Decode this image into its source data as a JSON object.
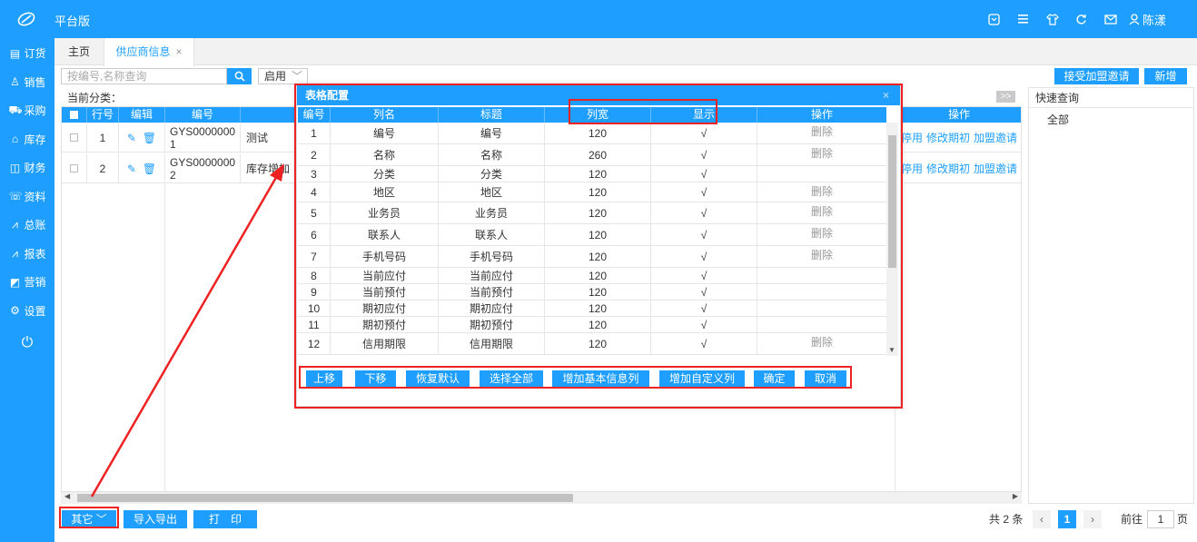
{
  "app": {
    "brand": "平台版",
    "user_name": "陈漾"
  },
  "colors": {
    "primary": "#1e9fff",
    "highlight": "#ee2222"
  },
  "sidebar": {
    "items": [
      {
        "icon": "order-icon",
        "label": "订货"
      },
      {
        "icon": "sales-icon",
        "label": "销售"
      },
      {
        "icon": "cart-icon",
        "label": "采购"
      },
      {
        "icon": "warehouse-icon",
        "label": "库存"
      },
      {
        "icon": "finance-icon",
        "label": "财务"
      },
      {
        "icon": "data-icon",
        "label": "资料"
      },
      {
        "icon": "ledger-icon",
        "label": "总账"
      },
      {
        "icon": "report-icon",
        "label": "报表"
      },
      {
        "icon": "marketing-icon",
        "label": "营销"
      },
      {
        "icon": "settings-icon",
        "label": "设置"
      }
    ]
  },
  "tabs": {
    "home": "主页",
    "supplier": "供应商信息",
    "close": "×"
  },
  "toolbar": {
    "search_placeholder": "按编号,名称查询",
    "status_value": "启用",
    "accept_invite": "接受加盟邀请",
    "add_new": "新增"
  },
  "category_label": "当前分类：",
  "expand_label": ">>",
  "grid": {
    "headers": {
      "row_no": "行号",
      "edit": "编辑",
      "code": "编号",
      "action": "操作"
    },
    "rows": [
      {
        "no": "1",
        "code": "GYS0000000\n1",
        "name": "测试",
        "actions": [
          "停用",
          "修改期初",
          "加盟邀请"
        ]
      },
      {
        "no": "2",
        "code": "GYS0000000\n2",
        "name": "库存增加",
        "actions": [
          "停用",
          "修改期初",
          "加盟邀请"
        ]
      }
    ]
  },
  "quick_query": {
    "title": "快速查询",
    "item": "全部"
  },
  "bottom": {
    "other": "其它",
    "import_export": "导入导出",
    "print": "打　印"
  },
  "pager": {
    "total": "共 2 条",
    "current_page": "1",
    "goto_label": "前往",
    "goto_value": "1",
    "page_suffix": "页"
  },
  "modal": {
    "title": "表格配置",
    "close": "×",
    "headers": {
      "no": "编号",
      "field": "列名",
      "title": "标题",
      "width": "列宽",
      "show": "显示",
      "action": "操作"
    },
    "rows": [
      {
        "no": "1",
        "field": "编号",
        "title": "编号",
        "width": "120",
        "show": "√",
        "action": "删除"
      },
      {
        "no": "2",
        "field": "名称",
        "title": "名称",
        "width": "260",
        "show": "√",
        "action": "删除"
      },
      {
        "no": "3",
        "field": "分类",
        "title": "分类",
        "width": "120",
        "show": "√",
        "action": ""
      },
      {
        "no": "4",
        "field": "地区",
        "title": "地区",
        "width": "120",
        "show": "√",
        "action": "删除"
      },
      {
        "no": "5",
        "field": "业务员",
        "title": "业务员",
        "width": "120",
        "show": "√",
        "action": "删除"
      },
      {
        "no": "6",
        "field": "联系人",
        "title": "联系人",
        "width": "120",
        "show": "√",
        "action": "删除"
      },
      {
        "no": "7",
        "field": "手机号码",
        "title": "手机号码",
        "width": "120",
        "show": "√",
        "action": "删除"
      },
      {
        "no": "8",
        "field": "当前应付",
        "title": "当前应付",
        "width": "120",
        "show": "√",
        "action": ""
      },
      {
        "no": "9",
        "field": "当前预付",
        "title": "当前预付",
        "width": "120",
        "show": "√",
        "action": ""
      },
      {
        "no": "10",
        "field": "期初应付",
        "title": "期初应付",
        "width": "120",
        "show": "√",
        "action": ""
      },
      {
        "no": "11",
        "field": "期初预付",
        "title": "期初预付",
        "width": "120",
        "show": "√",
        "action": ""
      },
      {
        "no": "12",
        "field": "信用期限",
        "title": "信用期限",
        "width": "120",
        "show": "√",
        "action": "删除"
      }
    ],
    "buttons": {
      "move_up": "上移",
      "move_down": "下移",
      "restore": "恢复默认",
      "select_all": "选择全部",
      "add_basic": "增加基本信息列",
      "add_custom": "增加自定义列",
      "confirm": "确定",
      "cancel": "取消"
    }
  }
}
